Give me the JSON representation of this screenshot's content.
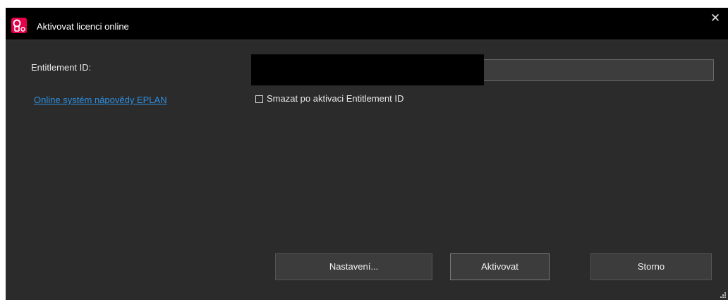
{
  "window": {
    "title": "Aktivovat licenci online",
    "close_glyph": "✕",
    "app_icon": "eplan-license-icon"
  },
  "form": {
    "entitlement_label": "Entitlement ID:",
    "entitlement_value": "",
    "help_link": "Online systém nápovědy EPLAN",
    "delete_checkbox_label": "Smazat po aktivaci Entitlement ID",
    "delete_checkbox_checked": false
  },
  "buttons": {
    "settings": "Nastavení...",
    "activate": "Aktivovat",
    "cancel": "Storno"
  },
  "colors": {
    "background": "#2b2b2b",
    "titlebar": "#000000",
    "accent_link": "#2f8fe0",
    "app_icon": "#e5004b"
  }
}
